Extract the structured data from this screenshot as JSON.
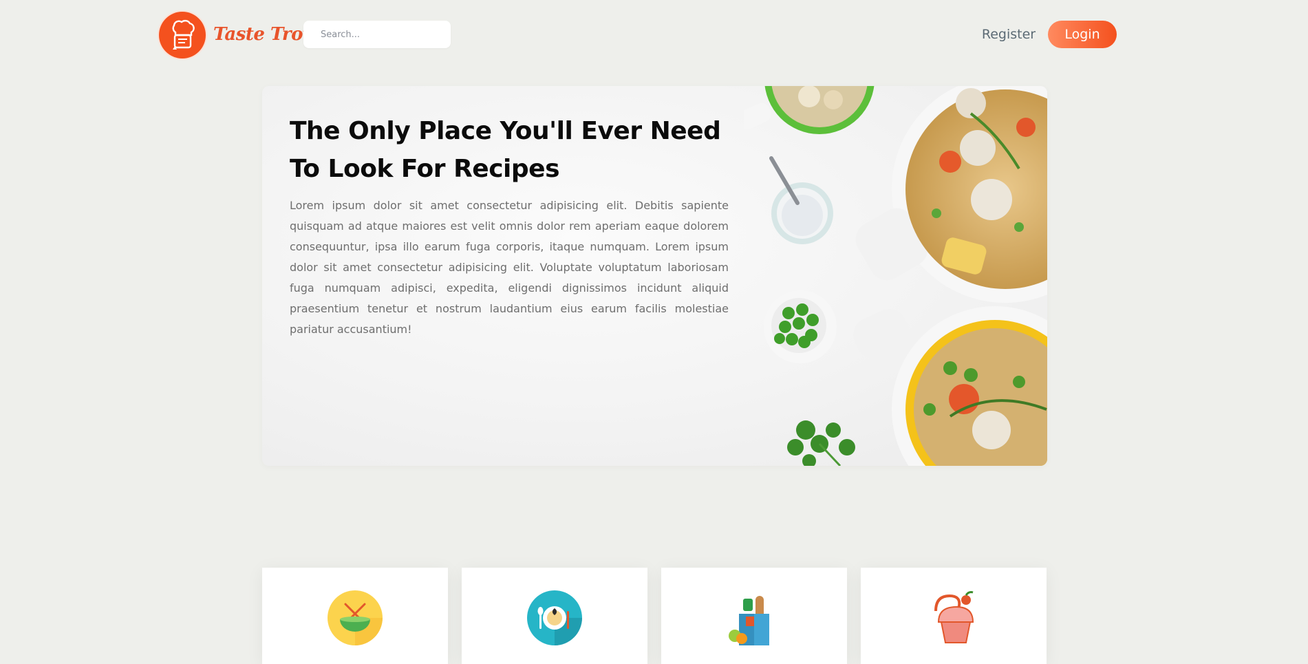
{
  "header": {
    "brand_name": "Taste Trove",
    "search": {
      "placeholder": "Search...",
      "value": ""
    },
    "register_label": "Register",
    "login_label": "Login",
    "brand_color": "#f4511e"
  },
  "hero": {
    "title": "The Only Place You'll Ever Need To Look For Recipes",
    "body": "Lorem ipsum dolor sit amet consectetur adipisicing elit. Debitis sapiente quisquam ad atque maiores est velit omnis dolor rem aperiam eaque dolorem consequuntur, ipsa illo earum fuga corporis, itaque numquam. Lorem ipsum dolor sit amet consectetur adipisicing elit. Voluptate voluptatum laboriosam fuga numquam adipisci, expedita, eligendi dignissimos incidunt aliquid praesentium tenetur et nostrum laudantium eius earum facilis molestiae pariatur accusantium!"
  },
  "categories": [
    {
      "icon": "noodle-bowl-icon"
    },
    {
      "icon": "dinner-plate-icon"
    },
    {
      "icon": "grocery-bag-icon"
    },
    {
      "icon": "cupcake-icon"
    }
  ]
}
